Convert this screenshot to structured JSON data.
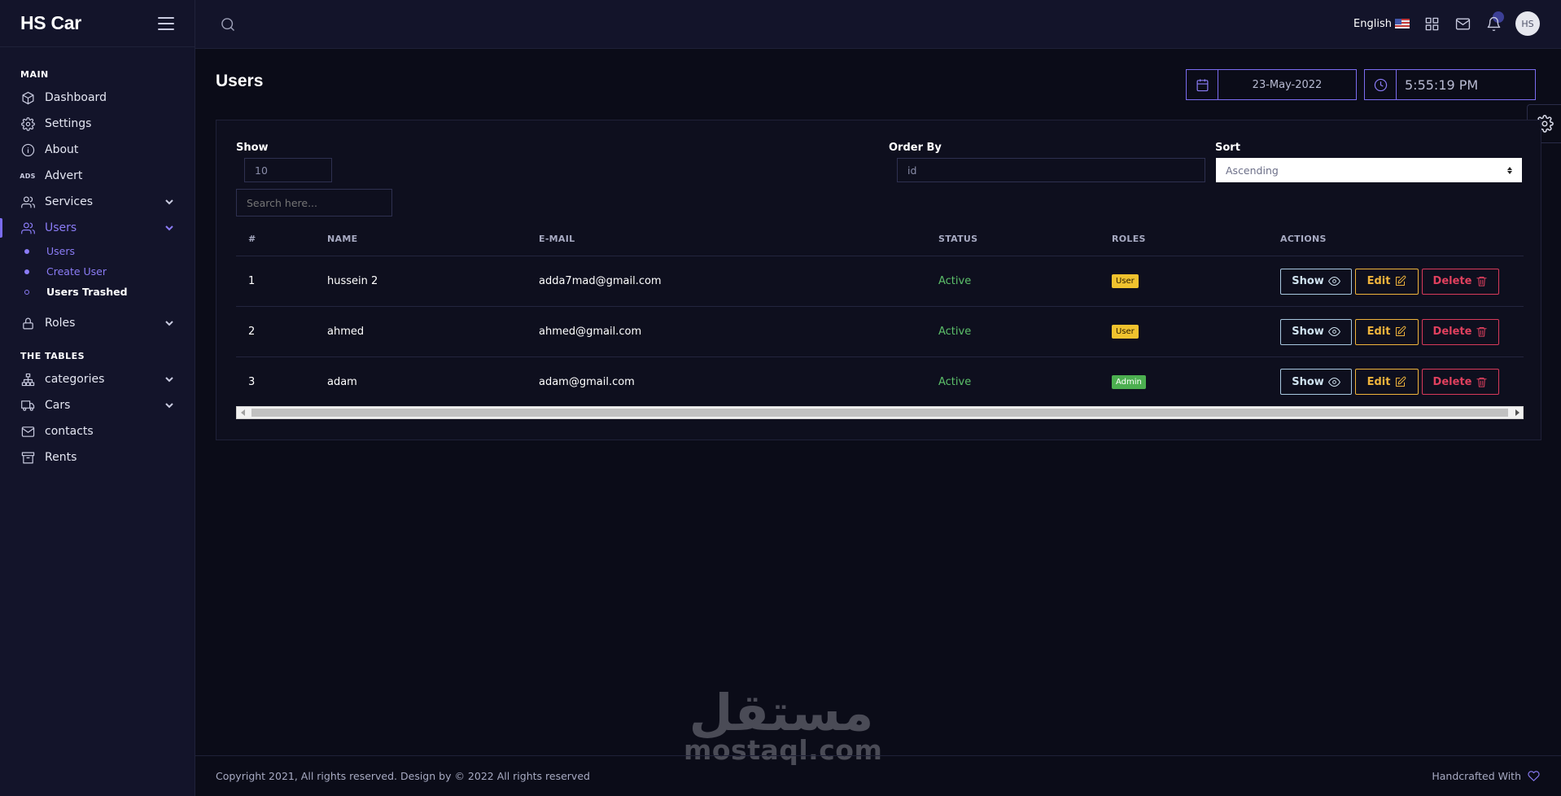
{
  "brand": {
    "name": "HS Car"
  },
  "sidebar": {
    "sections": {
      "main": "MAIN",
      "tables": "THE TABLES"
    },
    "items": {
      "dashboard": "Dashboard",
      "settings": "Settings",
      "about": "About",
      "advert": "Advert",
      "advert_icon": "ADS",
      "services": "Services",
      "users": "Users",
      "roles": "Roles",
      "categories": "categories",
      "cars": "Cars",
      "contacts": "contacts",
      "rents": "Rents"
    },
    "users_sub": {
      "users": "Users",
      "create_user": "Create User",
      "users_trashed": "Users Trashed"
    }
  },
  "topbar": {
    "language": "English",
    "avatar_initials": "HS"
  },
  "page": {
    "title": "Users",
    "date": "23-May-2022",
    "time": "5:55:19 PM"
  },
  "filters": {
    "show_label": "Show",
    "show_value": "10",
    "order_label": "Order By",
    "order_value": "id",
    "sort_label": "Sort",
    "sort_value": "Ascending",
    "search_placeholder": "Search here..."
  },
  "table": {
    "headers": [
      "#",
      "NAME",
      "E-MAIL",
      "STATUS",
      "ROLES",
      "ACTIONS"
    ],
    "rows": [
      {
        "id": "1",
        "name": "hussein 2",
        "email": "adda7mad@gmail.com",
        "status": "Active",
        "role": "User"
      },
      {
        "id": "2",
        "name": "ahmed",
        "email": "ahmed@gmail.com",
        "status": "Active",
        "role": "User"
      },
      {
        "id": "3",
        "name": "adam",
        "email": "adam@gmail.com",
        "status": "Active",
        "role": "Admin"
      }
    ],
    "actions": {
      "show": "Show",
      "edit": "Edit",
      "delete": "Delete"
    }
  },
  "watermark": {
    "arabic": "مستقل",
    "latin": "mostaql.com"
  },
  "footer": {
    "copyright": "Copyright 2021, All rights reserved. Design by © 2022 All rights reserved",
    "handcrafted": "Handcrafted With"
  },
  "colors": {
    "accent": "#7b6cf0",
    "background": "#0b0c18",
    "sidebar": "#13142a",
    "active_status": "#5cc06a",
    "role_user": "#f0c22e",
    "role_admin": "#4caf50",
    "delete": "#e0405e",
    "edit": "#f0b43c"
  }
}
